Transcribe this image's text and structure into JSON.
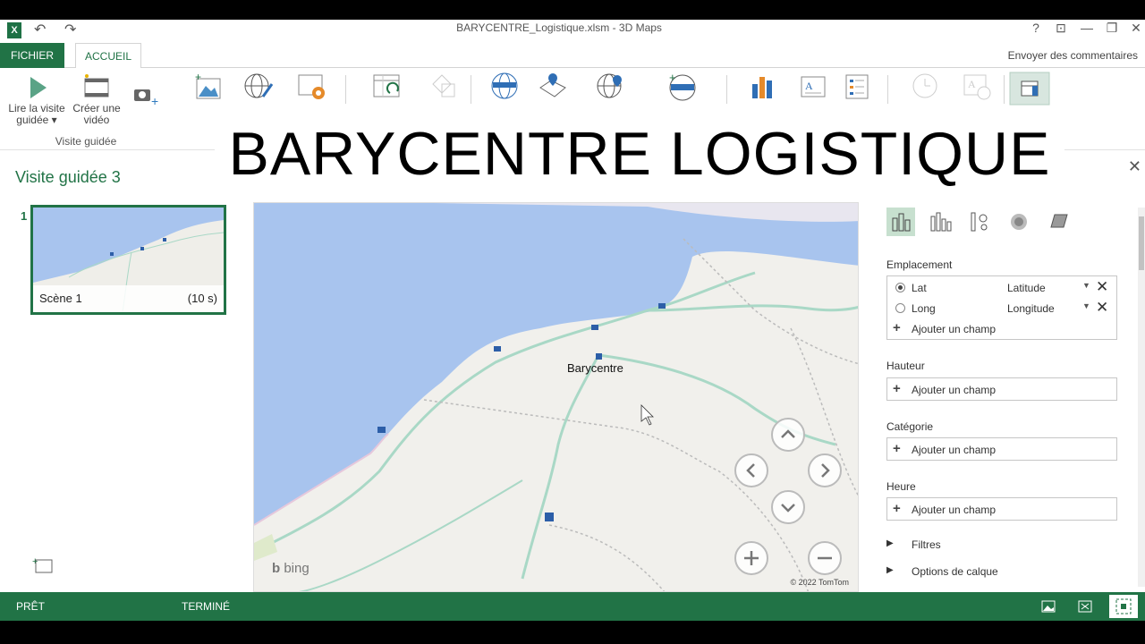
{
  "window": {
    "title": "BARYCENTRE_Logistique.xlsm - 3D Maps",
    "app_badge": "X",
    "undo_glyph": "↶",
    "redo_glyph": "↷",
    "help_glyph": "?",
    "restore_ribbon_glyph": "⊡",
    "minimize_glyph": "—",
    "maximize_glyph": "❐",
    "close_glyph": "✕"
  },
  "tabs": {
    "file": "FICHIER",
    "home": "ACCUEIL",
    "feedback": "Envoyer des commentaires"
  },
  "ribbon": {
    "play_tour": {
      "line1": "Lire la visite",
      "line2": "guidée ▾"
    },
    "create_video": {
      "line1": "Créer une",
      "line2": "vidéo"
    },
    "group_tour": "Visite guidée",
    "icons": [
      "play-icon",
      "film-icon",
      "camera-add-icon",
      "new-scene-icon",
      "themes-icon",
      "map-labels-icon",
      "flat-map-icon",
      "refresh-data-icon",
      "shapes-icon",
      "find-location-icon",
      "custom-regions-icon",
      "add-layer-icon",
      "chart-icon",
      "text-box-icon",
      "legend-icon",
      "timeline-icon",
      "date-time-icon",
      "layer-pane-icon"
    ]
  },
  "overlay_title": "BARYCENTRE LOGISTIQUE",
  "tour": {
    "title": "Visite guidée 3",
    "scenes": [
      {
        "number": "1",
        "name": "Scène 1",
        "duration": "(10 s)"
      }
    ]
  },
  "map": {
    "label": "Barycentre",
    "brand": "bing",
    "copyright": "© 2022 TomTom",
    "colors": {
      "sea": "#a8c4ee",
      "land": "#f1f0ec",
      "roads": "#a9d8c6",
      "markers": "#2c5ea8"
    }
  },
  "layer_pane": {
    "location_label": "Emplacement",
    "location_fields": [
      {
        "key": "Lat",
        "value": "Latitude",
        "selected": true
      },
      {
        "key": "Long",
        "value": "Longitude",
        "selected": false
      }
    ],
    "add_field": "Ajouter un champ",
    "height_label": "Hauteur",
    "category_label": "Catégorie",
    "time_label": "Heure",
    "filters": "Filtres",
    "layer_options": "Options de calque"
  },
  "status": {
    "ready": "PRÊT",
    "done": "TERMINÉ"
  },
  "accent": "#217346"
}
